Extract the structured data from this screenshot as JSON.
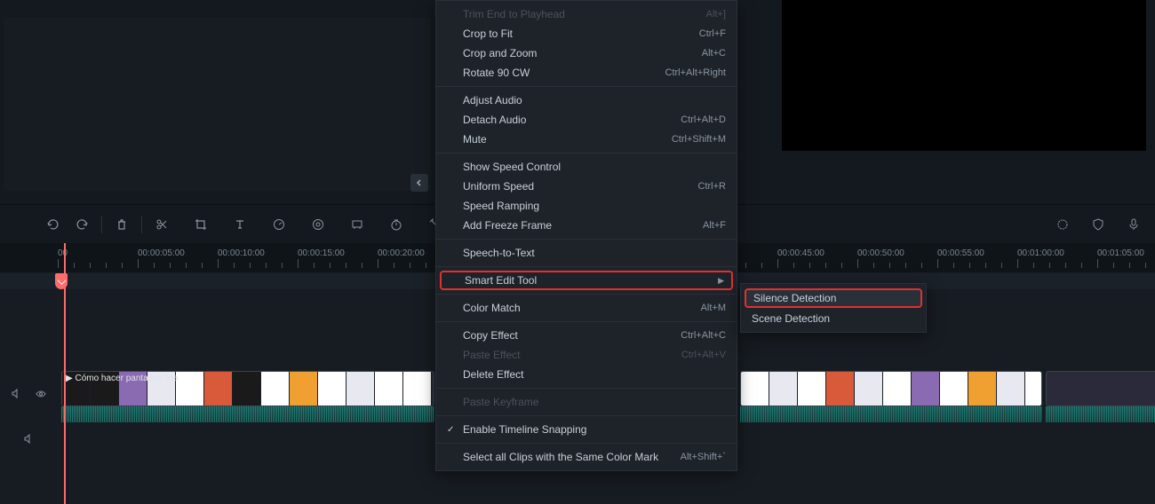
{
  "preview": {
    "controls": [
      "prev-frame",
      "play",
      "next",
      "stop"
    ]
  },
  "toolbar": {
    "icons": [
      "undo",
      "redo",
      "divider",
      "delete",
      "divider",
      "cut",
      "crop",
      "text",
      "rotate",
      "color",
      "marker",
      "speed",
      "fit",
      "tag",
      "settings"
    ]
  },
  "ruler": {
    "marks": [
      "00",
      "00:00:05:00",
      "00:00:10:00",
      "00:00:15:00",
      "00:00:20:00",
      "",
      "",
      "",
      "",
      "00:00:45:00",
      "00:00:50:00",
      "00:00:55:00",
      "00:01:00:00",
      "00:01:05:00"
    ]
  },
  "clip": {
    "label": "▶ Cómo hacer pantallas fina"
  },
  "context_menu": {
    "sections": [
      {
        "items": [
          {
            "label": "Trim End to Playhead",
            "shortcut": "Alt+]",
            "disabled": true
          },
          {
            "label": "Crop to Fit",
            "shortcut": "Ctrl+F"
          },
          {
            "label": "Crop and Zoom",
            "shortcut": "Alt+C"
          },
          {
            "label": "Rotate 90 CW",
            "shortcut": "Ctrl+Alt+Right"
          }
        ]
      },
      {
        "items": [
          {
            "label": "Adjust Audio",
            "shortcut": ""
          },
          {
            "label": "Detach Audio",
            "shortcut": "Ctrl+Alt+D"
          },
          {
            "label": "Mute",
            "shortcut": "Ctrl+Shift+M"
          }
        ]
      },
      {
        "items": [
          {
            "label": "Show Speed Control",
            "shortcut": ""
          },
          {
            "label": "Uniform Speed",
            "shortcut": "Ctrl+R"
          },
          {
            "label": "Speed Ramping",
            "shortcut": ""
          },
          {
            "label": "Add Freeze Frame",
            "shortcut": "Alt+F"
          }
        ]
      },
      {
        "items": [
          {
            "label": "Speech-to-Text",
            "shortcut": ""
          }
        ]
      },
      {
        "items": [
          {
            "label": "Smart Edit Tool",
            "shortcut": "",
            "highlighted": true,
            "arrow": true
          }
        ]
      },
      {
        "items": [
          {
            "label": "Color Match",
            "shortcut": "Alt+M"
          }
        ]
      },
      {
        "items": [
          {
            "label": "Copy Effect",
            "shortcut": "Ctrl+Alt+C"
          },
          {
            "label": "Paste Effect",
            "shortcut": "Ctrl+Alt+V",
            "disabled": true
          },
          {
            "label": "Delete Effect",
            "shortcut": ""
          }
        ]
      },
      {
        "items": [
          {
            "label": "Paste Keyframe",
            "shortcut": "",
            "disabled": true
          }
        ]
      },
      {
        "items": [
          {
            "label": "Enable Timeline Snapping",
            "shortcut": "",
            "checked": true
          }
        ]
      },
      {
        "items": [
          {
            "label": "Select all Clips with the Same Color Mark",
            "shortcut": "Alt+Shift+`"
          }
        ]
      }
    ]
  },
  "sub_menu": {
    "items": [
      {
        "label": "Silence Detection",
        "highlighted": true
      },
      {
        "label": "Scene Detection"
      }
    ]
  }
}
